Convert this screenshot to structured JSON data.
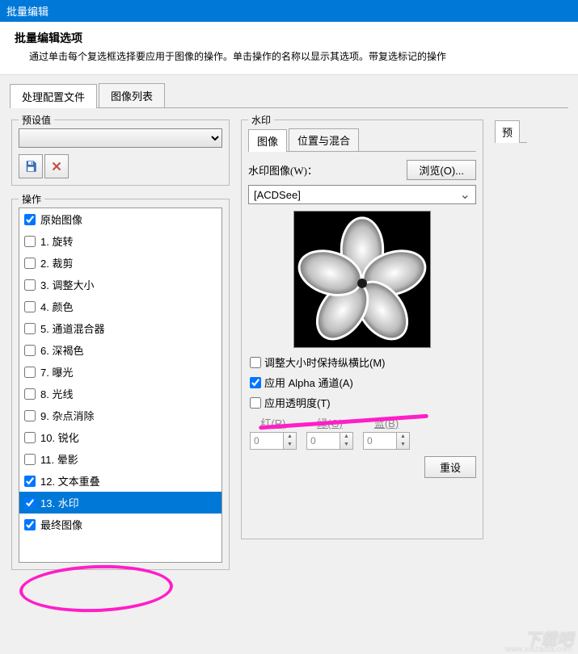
{
  "window": {
    "title": "批量编辑"
  },
  "header": {
    "title": "批量编辑选项",
    "desc": "通过单击每个复选框选择要应用于图像的操作。单击操作的名称以显示其选项。带复选标记的操作"
  },
  "tabs": {
    "t1": "处理配置文件",
    "t2": "图像列表"
  },
  "far_tab": "预",
  "preset": {
    "title": "预设值"
  },
  "ops": {
    "title": "操作",
    "items": [
      {
        "label": "原始图像",
        "checked": true,
        "selected": false
      },
      {
        "label": "1. 旋转",
        "checked": false,
        "selected": false
      },
      {
        "label": "2. 裁剪",
        "checked": false,
        "selected": false
      },
      {
        "label": "3. 调整大小",
        "checked": false,
        "selected": false
      },
      {
        "label": "4. 颜色",
        "checked": false,
        "selected": false
      },
      {
        "label": "5. 通道混合器",
        "checked": false,
        "selected": false
      },
      {
        "label": "6. 深褐色",
        "checked": false,
        "selected": false
      },
      {
        "label": "7. 曝光",
        "checked": false,
        "selected": false
      },
      {
        "label": "8. 光线",
        "checked": false,
        "selected": false
      },
      {
        "label": "9. 杂点消除",
        "checked": false,
        "selected": false
      },
      {
        "label": "10. 锐化",
        "checked": false,
        "selected": false
      },
      {
        "label": "11. 晕影",
        "checked": false,
        "selected": false
      },
      {
        "label": "12. 文本重叠",
        "checked": true,
        "selected": false
      },
      {
        "label": "13. 水印",
        "checked": true,
        "selected": true
      },
      {
        "label": "最终图像",
        "checked": true,
        "selected": false
      }
    ]
  },
  "wm": {
    "title": "水印",
    "tab_image": "图像",
    "tab_pos": "位置与混合",
    "image_label": "水印图像(W)：",
    "browse": "浏览(O)...",
    "select_value": "[ACDSee]",
    "keep_ratio": "调整大小时保持纵横比(M)",
    "apply_alpha": "应用 Alpha 通道(A)",
    "apply_opacity": "应用透明度(T)",
    "red": "红(R)",
    "green": "绿(G)",
    "blue": "蓝(B)",
    "rv": "0",
    "gv": "0",
    "bv": "0",
    "reset": "重设"
  },
  "brand": {
    "name": "下载吧",
    "url": "www.xiazaiba.com"
  }
}
